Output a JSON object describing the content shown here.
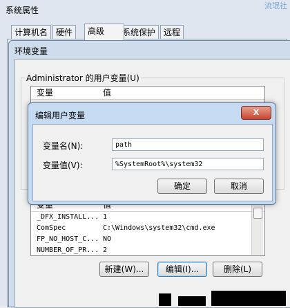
{
  "outer": {
    "title": "系统属性",
    "watermark": "流氓社",
    "tabs": [
      {
        "label": "计算机名"
      },
      {
        "label": "硬件"
      },
      {
        "label": "高级"
      },
      {
        "label": "系统保护"
      },
      {
        "label": "远程"
      }
    ]
  },
  "env": {
    "title": "环境变量",
    "user_group_label": "Administrator 的用户变量(U)",
    "user_columns": {
      "var": "变量",
      "val": "值"
    },
    "sys_columns": {
      "var": "变量",
      "val": "值"
    },
    "sys_rows": [
      {
        "name": "_DFX_INSTALL...",
        "value": "1"
      },
      {
        "name": "ComSpec",
        "value": "C:\\Windows\\system32\\cmd.exe"
      },
      {
        "name": "FP_NO_HOST_C...",
        "value": "NO"
      },
      {
        "name": "NUMBER_OF_PR...",
        "value": "2"
      }
    ],
    "buttons": {
      "new": "新建(W)...",
      "edit": "编辑(I)...",
      "delete": "删除(L)"
    }
  },
  "edit_dialog": {
    "title": "编辑用户变量",
    "close_glyph": "X",
    "name_label": "变量名(N):",
    "name_value": "path",
    "value_label": "变量值(V):",
    "value_value": "%SystemRoot%\\system32",
    "ok": "确定",
    "cancel": "取消"
  }
}
